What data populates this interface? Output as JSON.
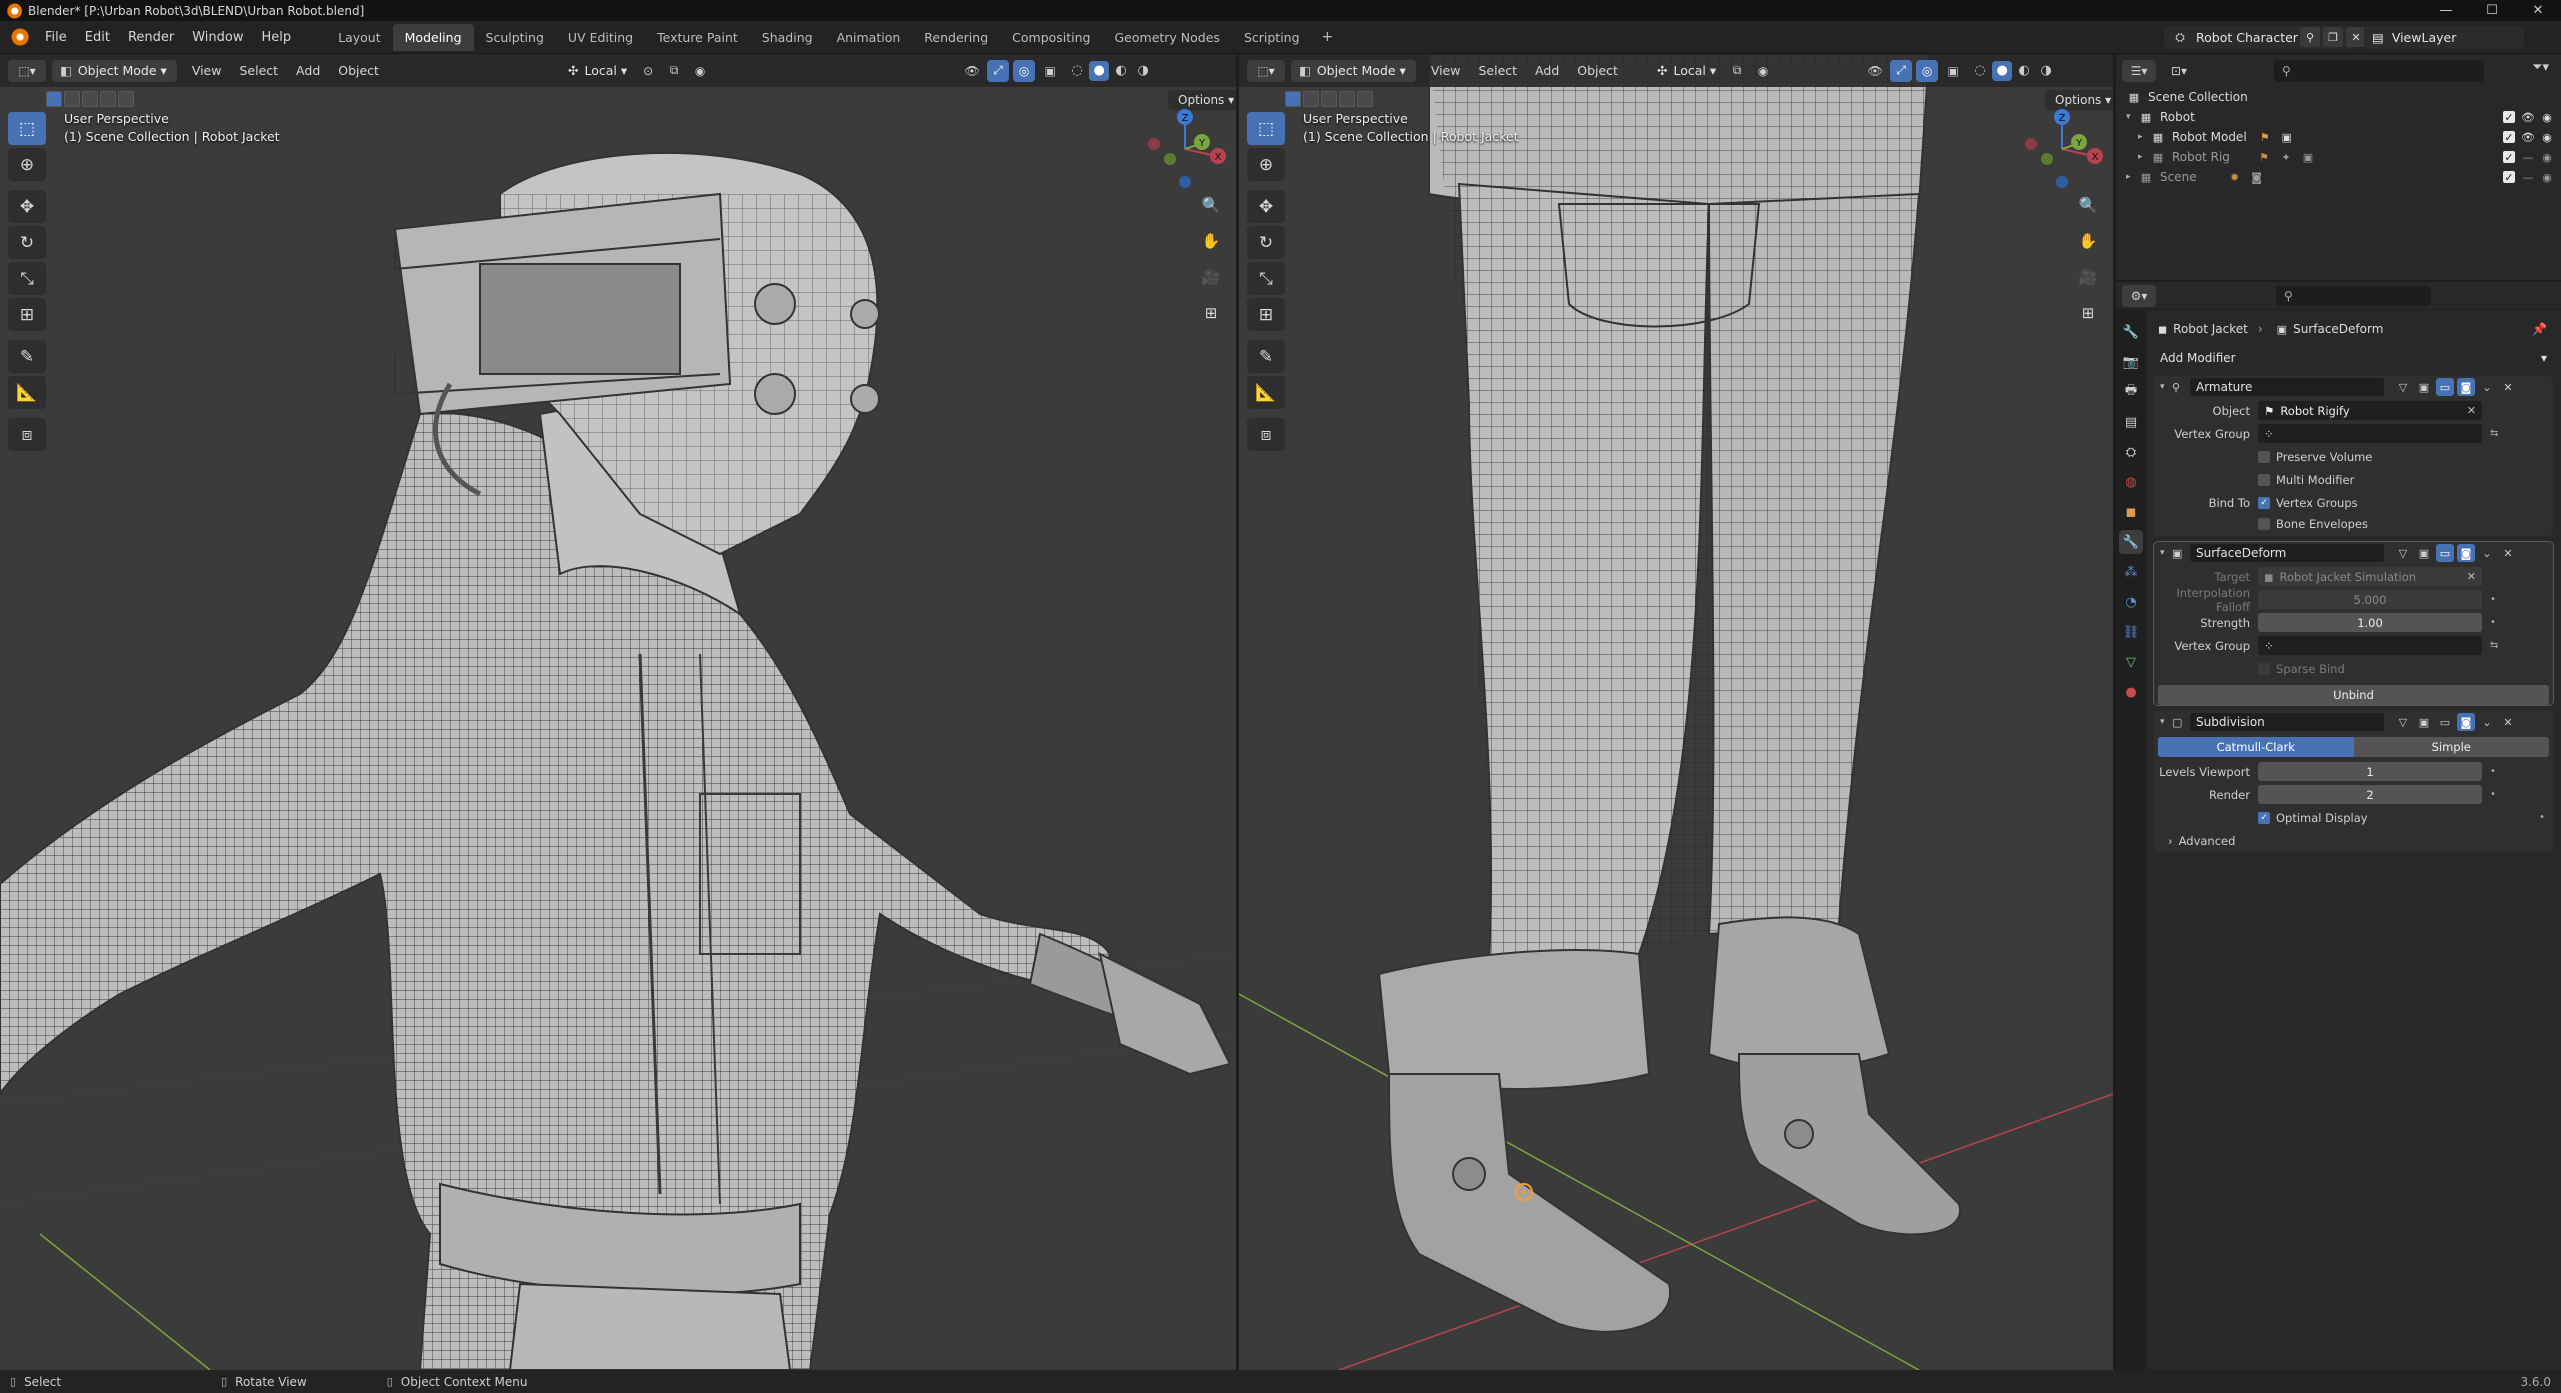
{
  "titlebar": {
    "title": "Blender* [P:\\Urban Robot\\3d\\BLEND\\Urban Robot.blend]",
    "minimize": "—",
    "maximize": "☐",
    "close": "✕"
  },
  "menu": {
    "file": "File",
    "edit": "Edit",
    "render": "Render",
    "window": "Window",
    "help": "Help"
  },
  "workspaces": [
    "Layout",
    "Modeling",
    "Sculpting",
    "UV Editing",
    "Texture Paint",
    "Shading",
    "Animation",
    "Rendering",
    "Compositing",
    "Geometry Nodes",
    "Scripting"
  ],
  "active_workspace": "Modeling",
  "scene": {
    "name": "Robot Character",
    "view_layer": "ViewLayer"
  },
  "viewports": {
    "left": {
      "mode": "Object Mode",
      "menus": [
        "View",
        "Select",
        "Add",
        "Object"
      ],
      "orientation": "Local",
      "options": "Options",
      "perspective": "User Perspective",
      "collection_info": "(1) Scene Collection | Robot Jacket"
    },
    "right": {
      "mode": "Object Mode",
      "menus": [
        "View",
        "Select",
        "Add",
        "Object"
      ],
      "orientation": "Local",
      "options": "Options",
      "perspective": "User Perspective",
      "collection_info": "(1) Scene Collection | Robot Jacket"
    }
  },
  "gizmo_axes": {
    "x": "X",
    "y": "Y",
    "z": "Z"
  },
  "outliner": {
    "rows": [
      {
        "label": "Scene Collection",
        "level": 0
      },
      {
        "label": "Robot",
        "level": 1
      },
      {
        "label": "Robot Model",
        "level": 2
      },
      {
        "label": "Robot Rig",
        "level": 2
      },
      {
        "label": "Scene",
        "level": 1
      }
    ]
  },
  "properties": {
    "breadcrumb_object": "Robot Jacket",
    "breadcrumb_modifier": "SurfaceDeform",
    "add_modifier": "Add Modifier",
    "armature": {
      "name": "Armature",
      "object_label": "Object",
      "object_value": "Robot Rigify",
      "vertex_group_label": "Vertex Group",
      "preserve_volume": "Preserve Volume",
      "multi_modifier": "Multi Modifier",
      "bind_to_label": "Bind To",
      "vertex_groups": "Vertex Groups",
      "bone_envelopes": "Bone Envelopes"
    },
    "surface_deform": {
      "name": "SurfaceDeform",
      "target_label": "Target",
      "target_value": "Robot Jacket Simulation",
      "falloff_label": "Interpolation Falloff",
      "falloff_value": "5.000",
      "strength_label": "Strength",
      "strength_value": "1.00",
      "vertex_group_label": "Vertex Group",
      "sparse_bind": "Sparse Bind",
      "unbind": "Unbind"
    },
    "subdivision": {
      "name": "Subdivision",
      "catmull_clark": "Catmull-Clark",
      "simple": "Simple",
      "levels_viewport_label": "Levels Viewport",
      "levels_viewport_value": "1",
      "render_label": "Render",
      "render_value": "2",
      "optimal_display": "Optimal Display",
      "advanced": "Advanced"
    }
  },
  "statusbar": {
    "select": "Select",
    "rotate_view": "Rotate View",
    "context_menu": "Object Context Menu",
    "version": "3.6.0"
  },
  "colors": {
    "accent": "#4772b3",
    "viewport_bg": "#3b3b3b",
    "mesh": "#bdbdbd",
    "wire": "#2a2a2a",
    "axis_x": "#b8434f",
    "axis_y": "#7ba53d",
    "axis_z": "#3a7bd5"
  }
}
